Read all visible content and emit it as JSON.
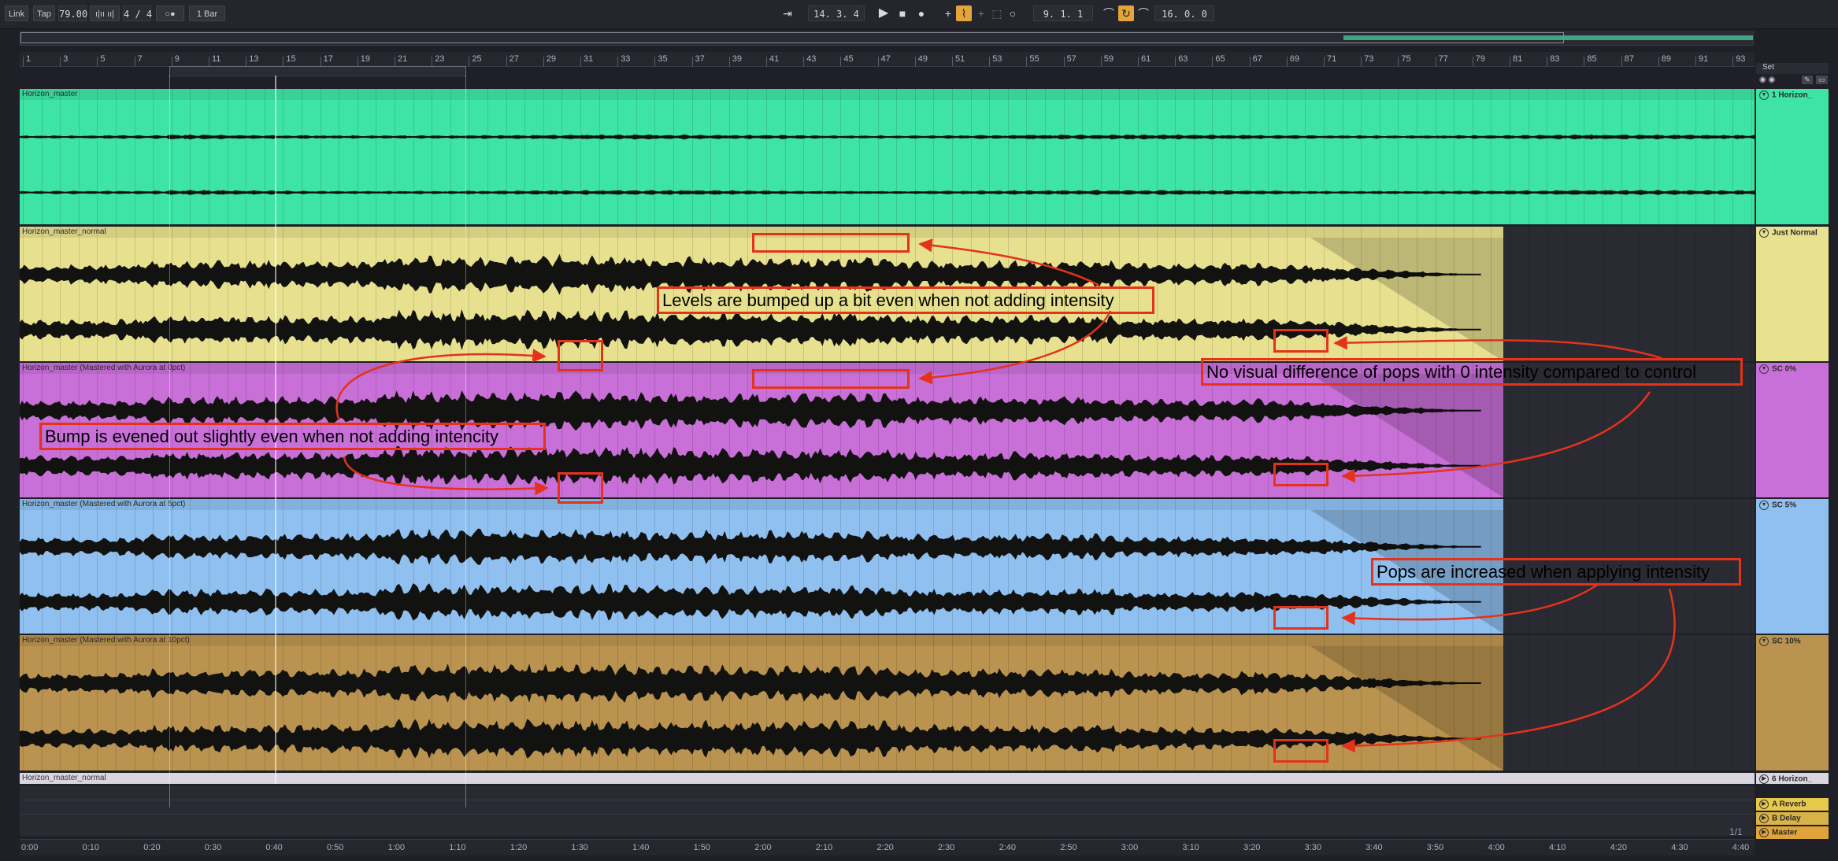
{
  "transport": {
    "link": "Link",
    "tap": "Tap",
    "tempo": "79.00",
    "nudge": "ı|ıı ıı|",
    "signature": "4 / 4",
    "metronome": "○●",
    "quantize": "1 Bar",
    "arrangement_position": "14.   3.   4",
    "loop_start": "9.   1.   1",
    "loop_length": "16.   0.   0"
  },
  "ruler": {
    "bars": [
      "1",
      "3",
      "5",
      "7",
      "9",
      "11",
      "13",
      "15",
      "17",
      "19",
      "21",
      "23",
      "25",
      "27",
      "29",
      "31",
      "33",
      "35",
      "37",
      "39",
      "41",
      "43",
      "45",
      "47",
      "49",
      "51",
      "53",
      "55",
      "57",
      "59",
      "61",
      "63",
      "65",
      "67",
      "69",
      "71",
      "73",
      "75",
      "77",
      "79",
      "81",
      "83",
      "85",
      "87",
      "89",
      "91",
      "93"
    ]
  },
  "tracks": [
    {
      "clip_name": "Horizon_master",
      "color": "#3de4a3",
      "panel_label": "1 Horizon_",
      "panel_color": "#3de4a3"
    },
    {
      "clip_name": "Horizon_master_normal",
      "color": "#e6e08f",
      "panel_label": "Just Normal",
      "panel_color": "#e8e190"
    },
    {
      "clip_name": "Horizon_master (Mastered with Aurora at 0pct)",
      "color": "#c86fd8",
      "panel_label": "SC 0%",
      "panel_color": "#c96fd9"
    },
    {
      "clip_name": "Horizon_master (Mastered with Aurora at 5pct)",
      "color": "#8fc0f0",
      "panel_label": "SC 5%",
      "panel_color": "#8fc0f0"
    },
    {
      "clip_name": "Horizon_master (Mastered with Aurora at 10pct)",
      "color": "#b9934f",
      "panel_label": "SC 10%",
      "panel_color": "#b9934f"
    }
  ],
  "collapsed_track": {
    "clip_name": "Horizon_master_normal",
    "panel_label": "6 Horizon_"
  },
  "set_label": "Set",
  "returns": [
    {
      "label": "A Reverb",
      "color": "#e6c94a"
    },
    {
      "label": "B Delay",
      "color": "#d9b24a"
    },
    {
      "label": "Master",
      "color": "#e0a43a"
    }
  ],
  "time_ruler": [
    "0:00",
    "0:10",
    "0:20",
    "0:30",
    "0:40",
    "0:50",
    "1:00",
    "1:10",
    "1:20",
    "1:30",
    "1:40",
    "1:50",
    "2:00",
    "2:10",
    "2:20",
    "2:30",
    "2:40",
    "2:50",
    "3:00",
    "3:10",
    "3:20",
    "3:30",
    "3:40",
    "3:50",
    "4:00",
    "4:10",
    "4:20",
    "4:30",
    "4:40"
  ],
  "page_indicator": "1/1",
  "annotations": [
    {
      "text": "Levels are bumped up a bit even when not adding intensity"
    },
    {
      "text": "No visual difference of pops with 0 intensity compared to control"
    },
    {
      "text": "Bump is evened out slightly even when not adding intencity"
    },
    {
      "text": "Pops are increased when applying intensity"
    }
  ],
  "annotation_color": "#e4321b"
}
